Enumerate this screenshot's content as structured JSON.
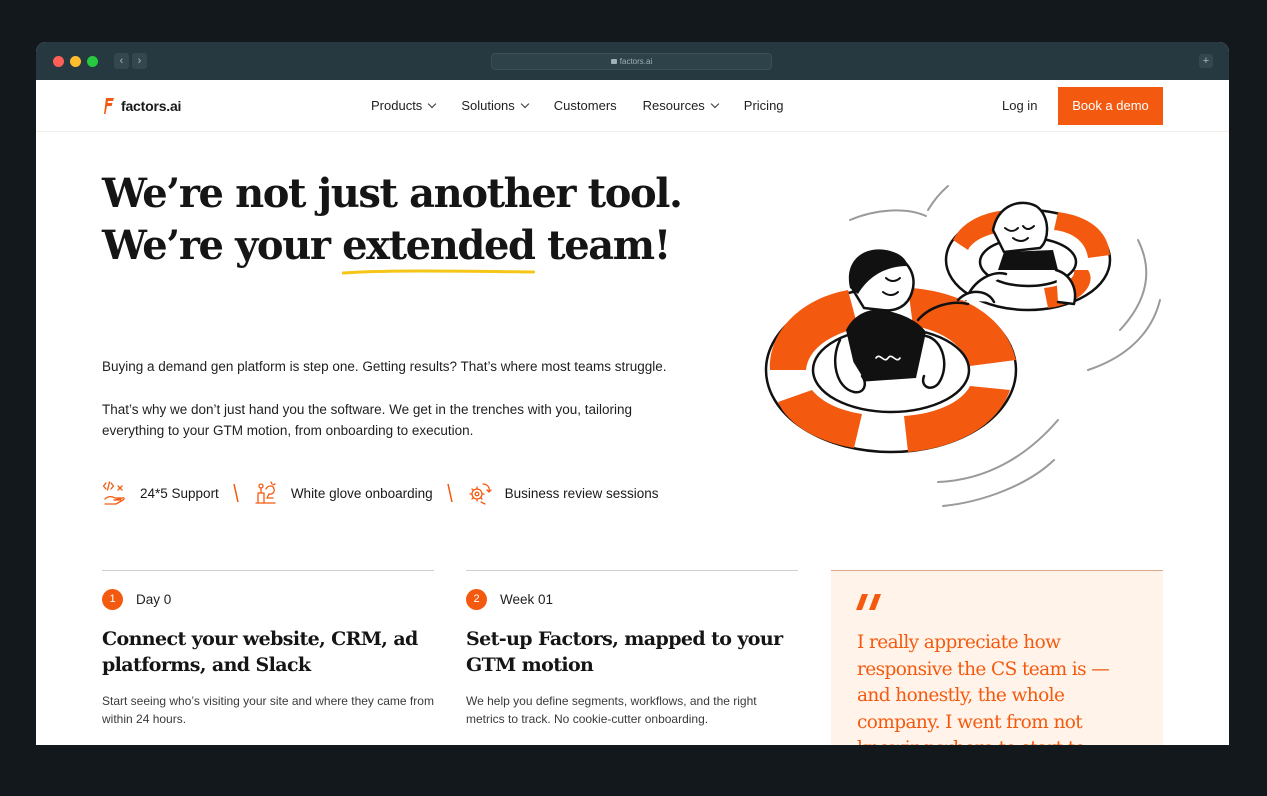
{
  "browser": {
    "url": "factors.ai",
    "back_icon": "chevron-left-icon",
    "forward_icon": "chevron-right-icon",
    "new_tab_icon": "plus-icon"
  },
  "header": {
    "brand": "factors.ai",
    "nav": [
      {
        "label": "Products",
        "has_dropdown": true
      },
      {
        "label": "Solutions",
        "has_dropdown": true
      },
      {
        "label": "Customers",
        "has_dropdown": false
      },
      {
        "label": "Resources",
        "has_dropdown": true
      },
      {
        "label": "Pricing",
        "has_dropdown": false
      }
    ],
    "login": "Log in",
    "cta": "Book a demo"
  },
  "hero": {
    "title_line1": "We’re not just another tool.",
    "title_line2_pre": "We’re your ",
    "title_line2_highlight": "extended",
    "title_line2_post": " team!",
    "para1": "Buying a demand gen platform is step one. Getting results? That’s where most teams struggle.",
    "para2": "That’s why we don’t just hand you the software. We get in the trenches with you, tailoring everything to your GTM motion, from onboarding to execution.",
    "features": [
      {
        "label": "24*5 Support",
        "icon": "support-icon"
      },
      {
        "label": "White glove onboarding",
        "icon": "onboarding-icon"
      },
      {
        "label": "Business review sessions",
        "icon": "review-sessions-icon"
      }
    ],
    "illustration": "people-in-swim-rings-illustration"
  },
  "steps": [
    {
      "number": "1",
      "label": "Day 0",
      "title": "Connect your website, CRM, ad platforms, and Slack",
      "description": "Start seeing who’s visiting your site and where they came from within 24 hours."
    },
    {
      "number": "2",
      "label": "Week 01",
      "title": "Set-up Factors, mapped to your GTM motion",
      "description": "We help you define segments, workflows, and the right metrics to track. No cookie-cutter onboarding."
    }
  ],
  "testimonial": {
    "mark": "“",
    "text": "I really appreciate how responsive the CS team is — and honestly, the whole company. I went from not knowing where to start to"
  },
  "colors": {
    "accent": "#f45a0f",
    "quote_bg": "#fff3ea",
    "chrome": "#263840",
    "backdrop": "#13181d",
    "highlight_underline": "#f5c518"
  }
}
